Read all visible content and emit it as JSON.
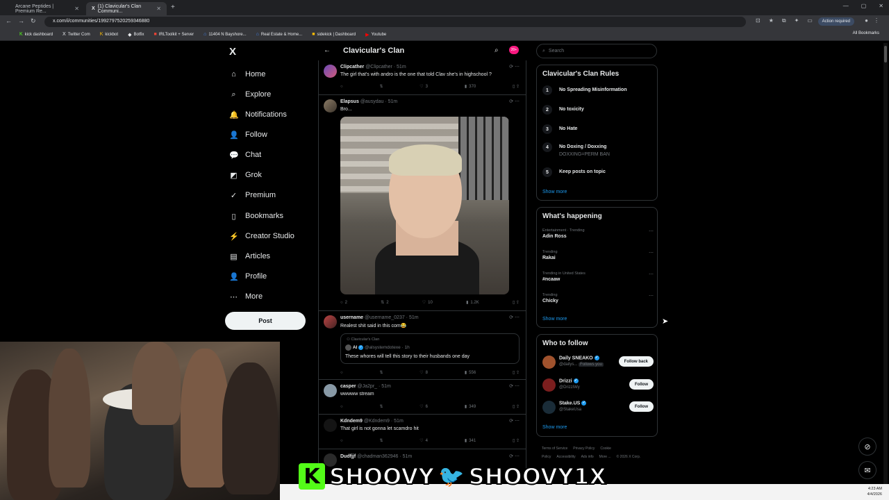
{
  "browser": {
    "tabs": [
      {
        "title": "Arcane Peptides | Premium Re...",
        "active": false
      },
      {
        "title": "(1) Clavicular's Clan Communi...",
        "active": true
      }
    ],
    "url": "x.com/i/communities/1992797520259346880",
    "action_required": "Action required",
    "bookmarks": [
      "kick dashboard",
      "Twitter Com",
      "kickbot",
      "Botfix",
      "IRLToolkit + Server",
      "11404 N Bayshore...",
      "Real Estate & Home...",
      "sidekick | Dashboard",
      "Youtube"
    ],
    "all_bookmarks": "All Bookmarks"
  },
  "nav": {
    "logo": "X",
    "items": [
      {
        "label": "Home",
        "icon": "home-icon",
        "glyph": "⌂"
      },
      {
        "label": "Explore",
        "icon": "search-icon",
        "glyph": "⌕"
      },
      {
        "label": "Notifications",
        "icon": "bell-icon",
        "glyph": "🔔"
      },
      {
        "label": "Follow",
        "icon": "person-add-icon",
        "glyph": "👤"
      },
      {
        "label": "Chat",
        "icon": "chat-icon",
        "glyph": "💬"
      },
      {
        "label": "Grok",
        "icon": "grok-icon",
        "glyph": "◩"
      },
      {
        "label": "Premium",
        "icon": "premium-icon",
        "glyph": "✓"
      },
      {
        "label": "Bookmarks",
        "icon": "bookmark-icon",
        "glyph": "▯"
      },
      {
        "label": "Creator Studio",
        "icon": "creator-studio-icon",
        "glyph": "⚡"
      },
      {
        "label": "Articles",
        "icon": "articles-icon",
        "glyph": "▤"
      },
      {
        "label": "Profile",
        "icon": "profile-icon",
        "glyph": "👤"
      },
      {
        "label": "More",
        "icon": "more-icon",
        "glyph": "⋯"
      }
    ],
    "post_button": "Post"
  },
  "feed": {
    "title": "Clavicular's Clan",
    "badge": "20+",
    "posts": [
      {
        "name": "Clipcather",
        "handle": "@Clipcather · 51m",
        "text": "The girl that's with andro is the one that told Clav she's in highschool ?",
        "likes": "3",
        "views": "370"
      },
      {
        "name": "Elapsus",
        "handle": "@ausydau · 51m",
        "text": "Bro...",
        "replies": "2",
        "reposts": "2",
        "likes": "10",
        "views": "1.2K"
      },
      {
        "name": "username",
        "handle": "@username_0237 · 51m",
        "text": "Realest shit said in this com😂",
        "quote_community": "Clavicular's Clan",
        "quote_name": "AI",
        "quote_handle": "@alsystemdotexe · 1h",
        "quote_text": "These whores will tell this story to their husbands one day",
        "likes": "8",
        "views": "556"
      },
      {
        "name": "casper",
        "handle": "@Ja2pr_ · 51m",
        "text": "wwwww stream",
        "likes": "6",
        "views": "349"
      },
      {
        "name": "Kdndem9",
        "handle": "@Kdndem9 · 51m",
        "text": "That girl is not gonna let scamdro hit",
        "likes": "4",
        "views": "341"
      },
      {
        "name": "Dudfjjf",
        "handle": "@chadman362946 · 51m",
        "text": ""
      }
    ]
  },
  "sidebar": {
    "search_placeholder": "Search",
    "rules_title": "Clavicular's Clan Rules",
    "rules": [
      {
        "num": "1",
        "text": "No Spreading Misinformation",
        "sub": ""
      },
      {
        "num": "2",
        "text": "No toxicity",
        "sub": ""
      },
      {
        "num": "3",
        "text": "No Hate",
        "sub": ""
      },
      {
        "num": "4",
        "text": "No Doxing / Doxxing",
        "sub": "DOXXING=PERM BAN"
      },
      {
        "num": "5",
        "text": "Keep posts on topic",
        "sub": ""
      }
    ],
    "show_more": "Show more",
    "happening_title": "What's happening",
    "trends": [
      {
        "context": "Entertainment · Trending",
        "name": "Adin Ross"
      },
      {
        "context": "Trending",
        "name": "Rakai"
      },
      {
        "context": "Trending in United States",
        "name": "#ncaaw"
      },
      {
        "context": "Trending",
        "name": "Chicky"
      }
    ],
    "who_title": "Who to follow",
    "who": [
      {
        "name": "Daily SNEAKO",
        "handle": "@dailys...",
        "note": "Follows you",
        "button": "Follow back",
        "color": "#a0522d"
      },
      {
        "name": "Drizzi",
        "handle": "@DrizziWy",
        "note": "",
        "button": "Follow",
        "color": "#7b1e1e"
      },
      {
        "name": "Stake.US",
        "handle": "@StakeUsa",
        "note": "",
        "button": "Follow",
        "color": "#1a2c38"
      }
    ],
    "footer": [
      "Terms of Service",
      "Privacy Policy",
      "Cookie Policy",
      "Accessibility",
      "Ads info",
      "More ...",
      "© 2026 X Corp."
    ]
  },
  "overlay": {
    "kick_letter": "K",
    "kick_name": "SHOOVY",
    "twitter_name": "SHOOVY1X"
  },
  "taskbar": {
    "time": "4:23 AM",
    "date": "4/4/2026"
  }
}
